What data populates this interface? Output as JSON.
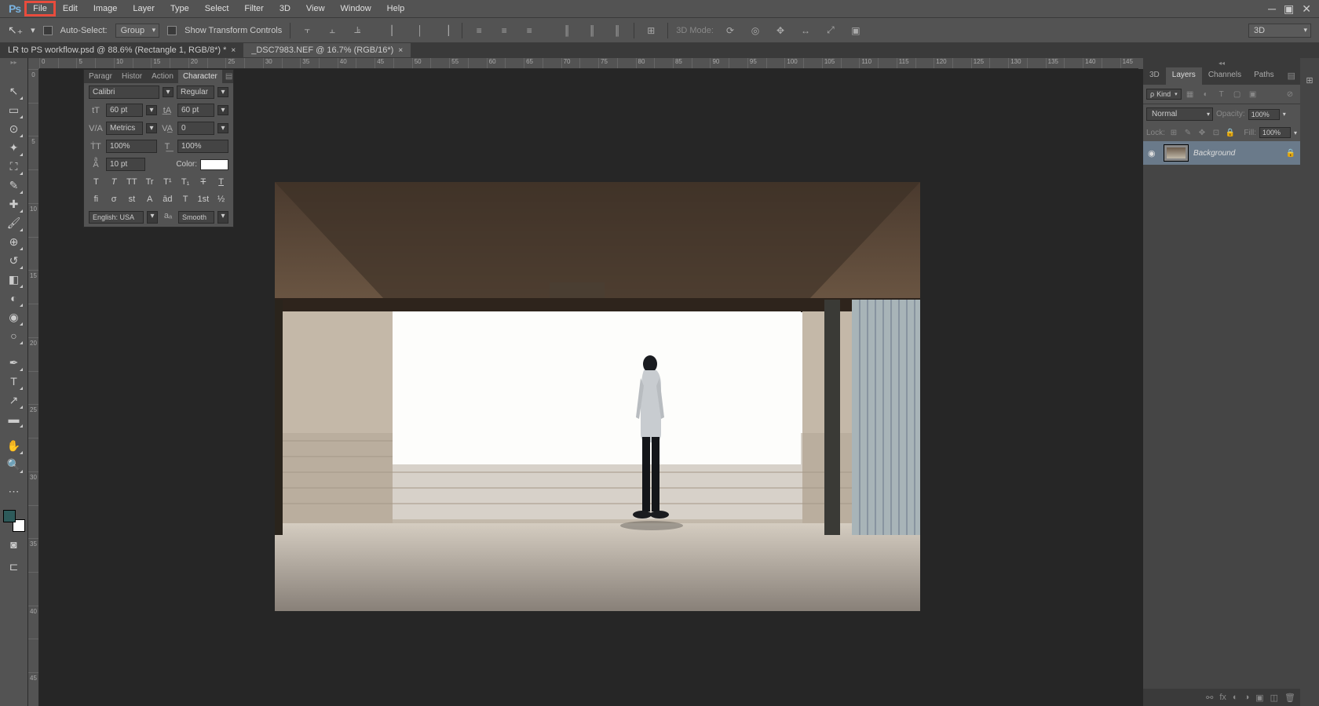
{
  "menubar": {
    "items": [
      "File",
      "Edit",
      "Image",
      "Layer",
      "Type",
      "Select",
      "Filter",
      "3D",
      "View",
      "Window",
      "Help"
    ],
    "highlighted": "File"
  },
  "options_bar": {
    "auto_select_label": "Auto-Select:",
    "group_label": "Group",
    "show_transform_label": "Show Transform Controls",
    "mode_3d_label": "3D Mode:",
    "render_dd": "3D"
  },
  "doc_tabs": [
    {
      "label": "LR to PS workflow.psd @ 88.6% (Rectangle 1, RGB/8*) *",
      "active": false
    },
    {
      "label": "_DSC7983.NEF @ 16.7% (RGB/16*)",
      "active": true
    }
  ],
  "ruler_h": [
    "0",
    "",
    "5",
    "",
    "10",
    "",
    "15",
    "",
    "20",
    "",
    "25",
    "",
    "30",
    "",
    "35",
    "",
    "40",
    "",
    "45",
    "",
    "50",
    "",
    "55",
    "",
    "60",
    "",
    "65",
    "",
    "70",
    "",
    "75",
    "",
    "80",
    "",
    "85",
    "",
    "90",
    "",
    "95",
    "",
    "100",
    "",
    "105",
    "",
    "110",
    "",
    "115",
    "",
    "120",
    "",
    "125",
    "",
    "130",
    "",
    "135",
    "",
    "140",
    "",
    "145"
  ],
  "ruler_v": [
    "0",
    "",
    "5",
    "",
    "10",
    "",
    "15",
    "",
    "20",
    "",
    "25",
    "",
    "30",
    "",
    "35",
    "",
    "40",
    "",
    "45"
  ],
  "tools": [
    {
      "name": "move-tool",
      "glyph": "↖"
    },
    {
      "name": "marquee-tool",
      "glyph": "▭"
    },
    {
      "name": "lasso-tool",
      "glyph": "⊙"
    },
    {
      "name": "wand-tool",
      "glyph": "✦"
    },
    {
      "name": "crop-tool",
      "glyph": "⛶"
    },
    {
      "name": "eyedropper-tool",
      "glyph": "✎"
    },
    {
      "name": "healing-tool",
      "glyph": "✚"
    },
    {
      "name": "brush-tool",
      "glyph": "🖌"
    },
    {
      "name": "stamp-tool",
      "glyph": "⊕"
    },
    {
      "name": "history-brush",
      "glyph": "↺"
    },
    {
      "name": "eraser-tool",
      "glyph": "◧"
    },
    {
      "name": "gradient-tool",
      "glyph": "◐"
    },
    {
      "name": "blur-tool",
      "glyph": "◉"
    },
    {
      "name": "dodge-tool",
      "glyph": "○"
    },
    {
      "name": "pen-tool",
      "glyph": "✒"
    },
    {
      "name": "type-tool",
      "glyph": "T"
    },
    {
      "name": "path-tool",
      "glyph": "↗"
    },
    {
      "name": "shape-tool",
      "glyph": "▬"
    },
    {
      "name": "hand-tool",
      "glyph": "✋"
    },
    {
      "name": "zoom-tool",
      "glyph": "🔍"
    }
  ],
  "char_panel": {
    "tabs": [
      "Paragr",
      "Histor",
      "Action",
      "Character"
    ],
    "active_tab": "Character",
    "font": "Calibri",
    "style": "Regular",
    "size": "60 pt",
    "leading": "60 pt",
    "kerning": "Metrics",
    "tracking": "0",
    "vscale": "100%",
    "hscale": "100%",
    "baseline": "10 pt",
    "color_label": "Color:",
    "type_btns1": [
      "T",
      "T",
      "TT",
      "Tr",
      "T¹",
      "T₁",
      "T",
      "T"
    ],
    "type_btns2": [
      "fi",
      "σ",
      "st",
      "A",
      "ād",
      "T",
      "1st",
      "½"
    ],
    "language": "English: USA",
    "aa_icon": "aₐ",
    "anti_alias": "Smooth"
  },
  "right_panels": {
    "top_tabs": [
      "3D",
      "Layers",
      "Channels",
      "Paths"
    ],
    "active_top": "Layers",
    "filter_label": "Kind",
    "blend_mode": "Normal",
    "opacity_label": "Opacity:",
    "opacity_value": "100%",
    "lock_label": "Lock:",
    "fill_label": "Fill:",
    "fill_value": "100%",
    "layer_name": "Background"
  }
}
